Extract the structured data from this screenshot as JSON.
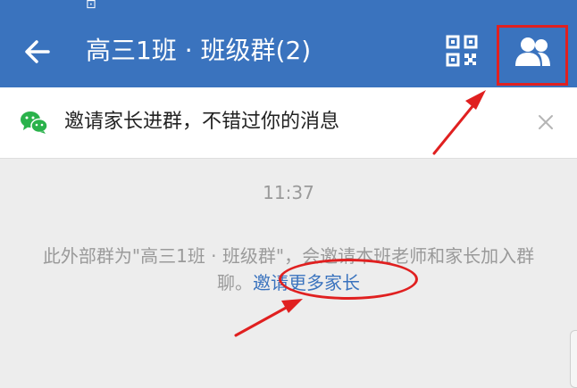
{
  "status_bar": {
    "glyph": "✂"
  },
  "header": {
    "title": "高三1班 · 班级群(2)",
    "back_icon": "arrow-left-icon",
    "qr_icon": "qr-code-icon",
    "members_icon": "group-members-icon",
    "background_color": "#3a73be"
  },
  "invite_banner": {
    "text": "邀请家长进群，不错过你的消息",
    "icon": "wechat-icon",
    "close_icon": "close-icon"
  },
  "chat": {
    "timestamp": "11:37",
    "system_message": "此外部群为\"高三1班 · 班级群\"，会邀请本班老师和家长加入群聊。",
    "invite_link": "邀请更多家长",
    "link_color": "#3a73be"
  },
  "annotations": {
    "highlight_color": "#e02020"
  }
}
